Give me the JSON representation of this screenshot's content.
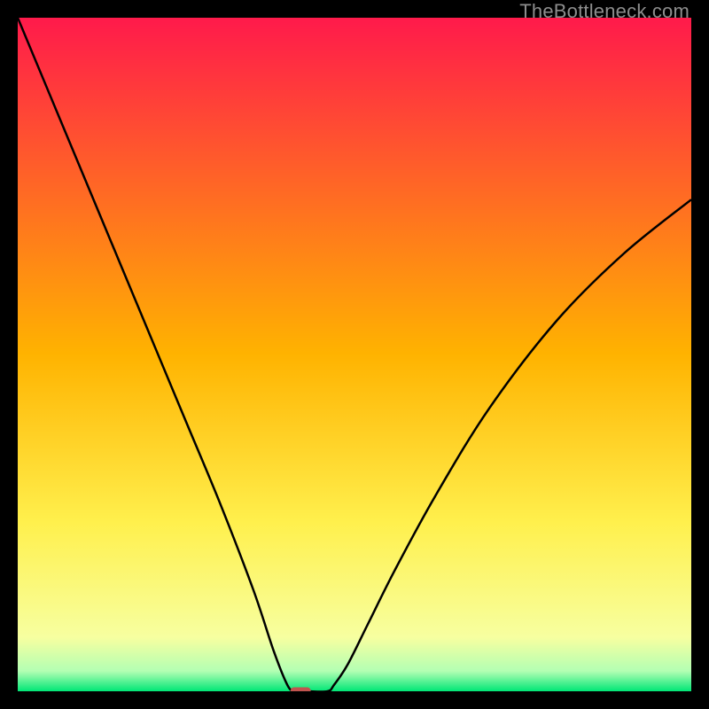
{
  "watermark": "TheBottleneck.com",
  "chart_data": {
    "type": "line",
    "title": "",
    "xlabel": "",
    "ylabel": "",
    "xlim": [
      0,
      100
    ],
    "ylim": [
      0,
      100
    ],
    "grid": false,
    "legend": false,
    "background_gradient": {
      "stops": [
        {
          "offset": 0.0,
          "color": "#ff1a4b"
        },
        {
          "offset": 0.5,
          "color": "#ffb300"
        },
        {
          "offset": 0.75,
          "color": "#fff04d"
        },
        {
          "offset": 0.92,
          "color": "#f7ffa0"
        },
        {
          "offset": 0.97,
          "color": "#b3ffb3"
        },
        {
          "offset": 1.0,
          "color": "#00e676"
        }
      ]
    },
    "series": [
      {
        "name": "bottleneck-curve",
        "color": "#000000",
        "x": [
          0,
          5,
          10,
          15,
          20,
          25,
          30,
          35,
          38,
          40,
          41,
          42,
          43,
          46,
          47,
          49,
          52,
          56,
          62,
          70,
          80,
          90,
          100
        ],
        "y": [
          100,
          88,
          76,
          64,
          52,
          40,
          28,
          15,
          6,
          1,
          0,
          0,
          0,
          0,
          1,
          4,
          10,
          18,
          29,
          42,
          55,
          65,
          73
        ]
      }
    ],
    "marker": {
      "name": "optimal-point",
      "x": 42,
      "y": 0,
      "width_pct": 3.0,
      "height_pct": 1.2,
      "color": "#c1544f"
    }
  }
}
